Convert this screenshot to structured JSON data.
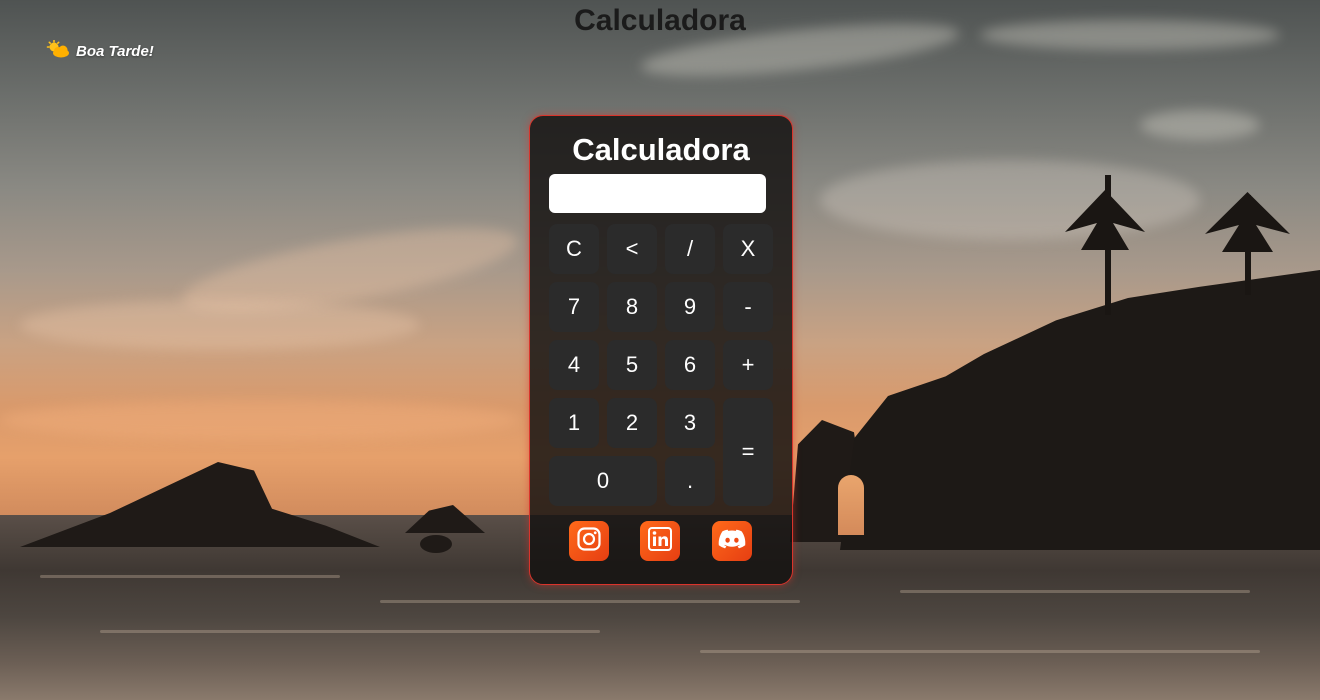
{
  "page": {
    "title": "Calculadora"
  },
  "greeting": {
    "text": "Boa Tarde!",
    "icon": "sun-cloud-icon"
  },
  "calculator": {
    "title": "Calculadora",
    "display_value": "",
    "buttons": {
      "clear": "C",
      "backspace": "<",
      "divide": "/",
      "multiply": "X",
      "seven": "7",
      "eight": "8",
      "nine": "9",
      "minus": "-",
      "four": "4",
      "five": "5",
      "six": "6",
      "plus": "+",
      "one": "1",
      "two": "2",
      "three": "3",
      "equals": "=",
      "zero": "0",
      "decimal": "."
    },
    "social": [
      {
        "name": "instagram-icon"
      },
      {
        "name": "linkedin-icon"
      },
      {
        "name": "discord-icon"
      }
    ]
  },
  "colors": {
    "accent": "#d9342b",
    "social_bg": "#ff5a12",
    "button_bg": "#2b2b2b"
  }
}
